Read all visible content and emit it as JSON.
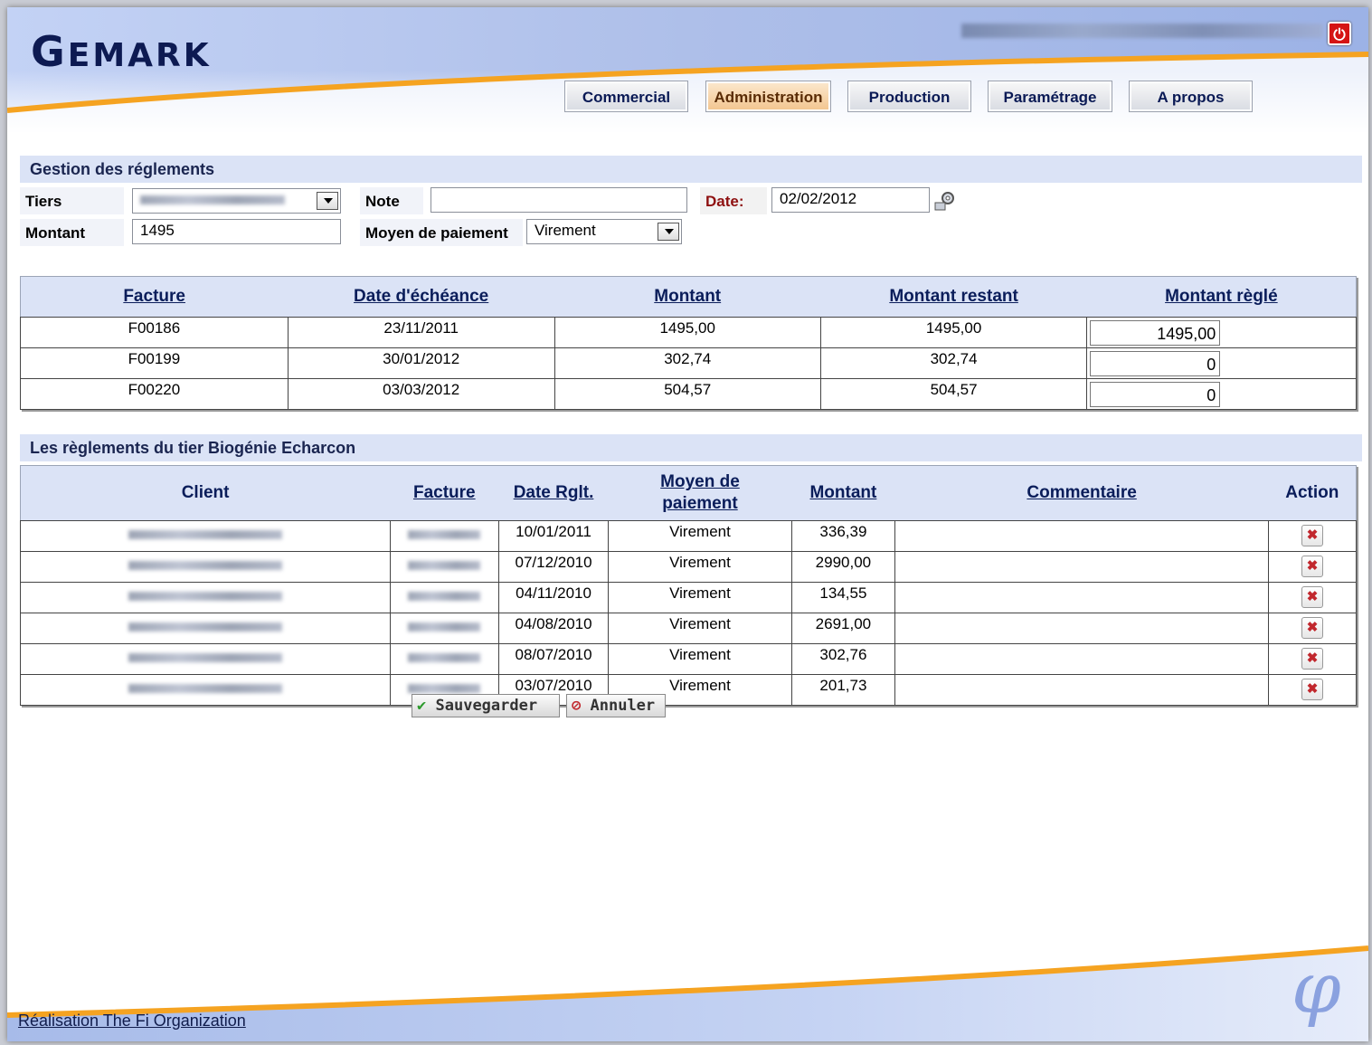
{
  "app": {
    "logo_big": "G",
    "logo_rest": "EMARK"
  },
  "nav": [
    {
      "label": "Commercial"
    },
    {
      "label": "Administration",
      "active": true
    },
    {
      "label": "Production"
    },
    {
      "label": "Paramétrage"
    },
    {
      "label": "A propos"
    }
  ],
  "form": {
    "title": "Gestion des réglements",
    "tiers_label": "Tiers",
    "note_label": "Note",
    "note_value": "",
    "date_label": "Date:",
    "date_value": "02/02/2012",
    "montant_label": "Montant",
    "montant_value": "1495",
    "moyen_label": "Moyen de paiement",
    "moyen_value": "Virement"
  },
  "invoices": {
    "headers": [
      "Facture",
      "Date d'échéance",
      "Montant",
      "Montant restant",
      "Montant règlé"
    ],
    "rows": [
      {
        "facture": "F00186",
        "echeance": "23/11/2011",
        "montant": "1495,00",
        "restant": "1495,00",
        "regle": "1495,00"
      },
      {
        "facture": "F00199",
        "echeance": "30/01/2012",
        "montant": "302,74",
        "restant": "302,74",
        "regle": "0"
      },
      {
        "facture": "F00220",
        "echeance": "03/03/2012",
        "montant": "504,57",
        "restant": "504,57",
        "regle": "0"
      }
    ]
  },
  "history": {
    "title": "Les règlements du tier Biogénie Echarcon",
    "headers": {
      "client": "Client",
      "facture": "Facture",
      "date": "Date Rglt.",
      "moyen_1": "Moyen de",
      "moyen_2": "paiement",
      "montant": "Montant",
      "commentaire": "Commentaire",
      "action": "Action"
    },
    "rows": [
      {
        "date": "10/01/2011",
        "moyen": "Virement",
        "montant": "336,39",
        "commentaire": ""
      },
      {
        "date": "07/12/2010",
        "moyen": "Virement",
        "montant": "2990,00",
        "commentaire": ""
      },
      {
        "date": "04/11/2010",
        "moyen": "Virement",
        "montant": "134,55",
        "commentaire": ""
      },
      {
        "date": "04/08/2010",
        "moyen": "Virement",
        "montant": "2691,00",
        "commentaire": ""
      },
      {
        "date": "08/07/2010",
        "moyen": "Virement",
        "montant": "302,76",
        "commentaire": ""
      },
      {
        "date": "03/07/2010",
        "moyen": "Virement",
        "montant": "201,73",
        "commentaire": ""
      }
    ]
  },
  "actions": {
    "save": "Sauvegarder",
    "cancel": "Annuler"
  },
  "footer": {
    "link": "Réalisation The Fi Organization",
    "logo": "φ"
  },
  "icons": {
    "power": "power-icon",
    "calendar": "calendar-icon",
    "delete": "delete-icon",
    "check": "check-icon",
    "cancel": "cancel-icon"
  },
  "colors": {
    "brand_navy": "#0d1a52",
    "accent_orange": "#f5a321",
    "header_blue": "#dbe3f6",
    "delete_red": "#c1272d"
  }
}
